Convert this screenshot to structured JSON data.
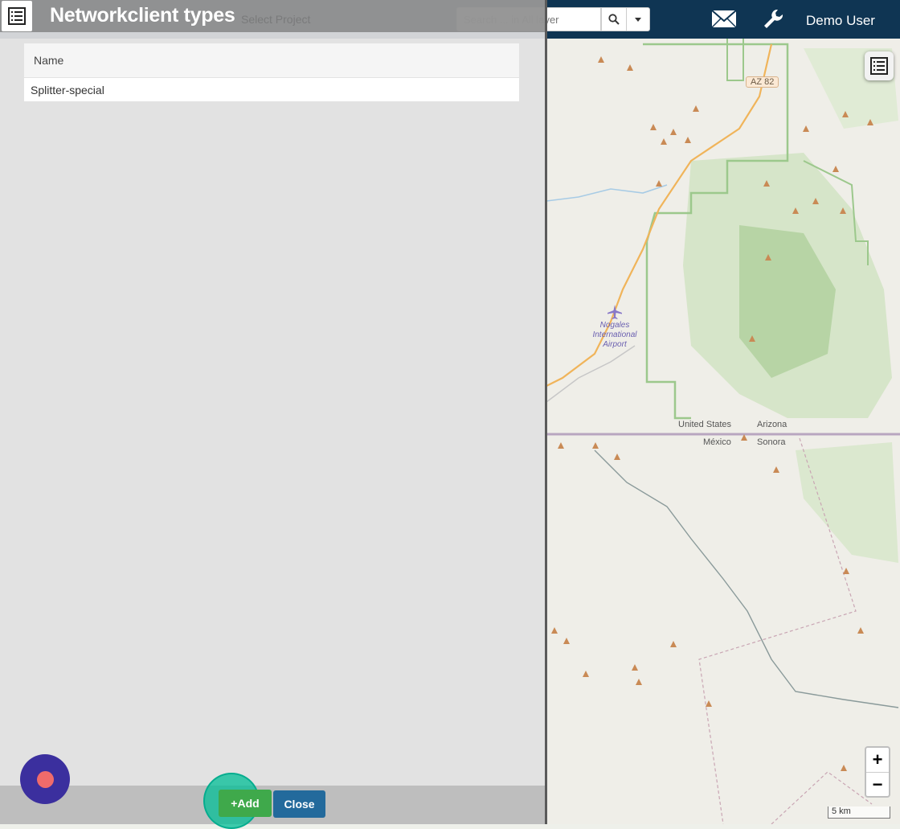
{
  "navbar": {
    "search_placeholder": "Search ... in All layer",
    "search_icon": "search-icon",
    "caret_icon": "caret-down-icon",
    "mail_icon": "mail-icon",
    "settings_icon": "wrench-icon",
    "user_name": "Demo User"
  },
  "panel": {
    "title": "Networkclient types",
    "ghost_project": "Select Project",
    "table": {
      "columns": [
        "Name"
      ],
      "rows": [
        [
          "Splitter-special"
        ]
      ]
    },
    "buttons": {
      "add": "+Add",
      "close": "Close"
    }
  },
  "map": {
    "labels": {
      "road": "AZ 82",
      "airport_1": "Nogales",
      "airport_2": "International",
      "airport_3": "Airport",
      "us": "United States",
      "arizona": "Arizona",
      "mexico": "México",
      "sonora": "Sonora"
    },
    "zoom_in": "+",
    "zoom_out": "−",
    "scale": "5 km"
  },
  "colors": {
    "navbar": "#0f3553",
    "add": "#3fa94b",
    "close": "#236a9c",
    "record": "#3b2f9e"
  }
}
